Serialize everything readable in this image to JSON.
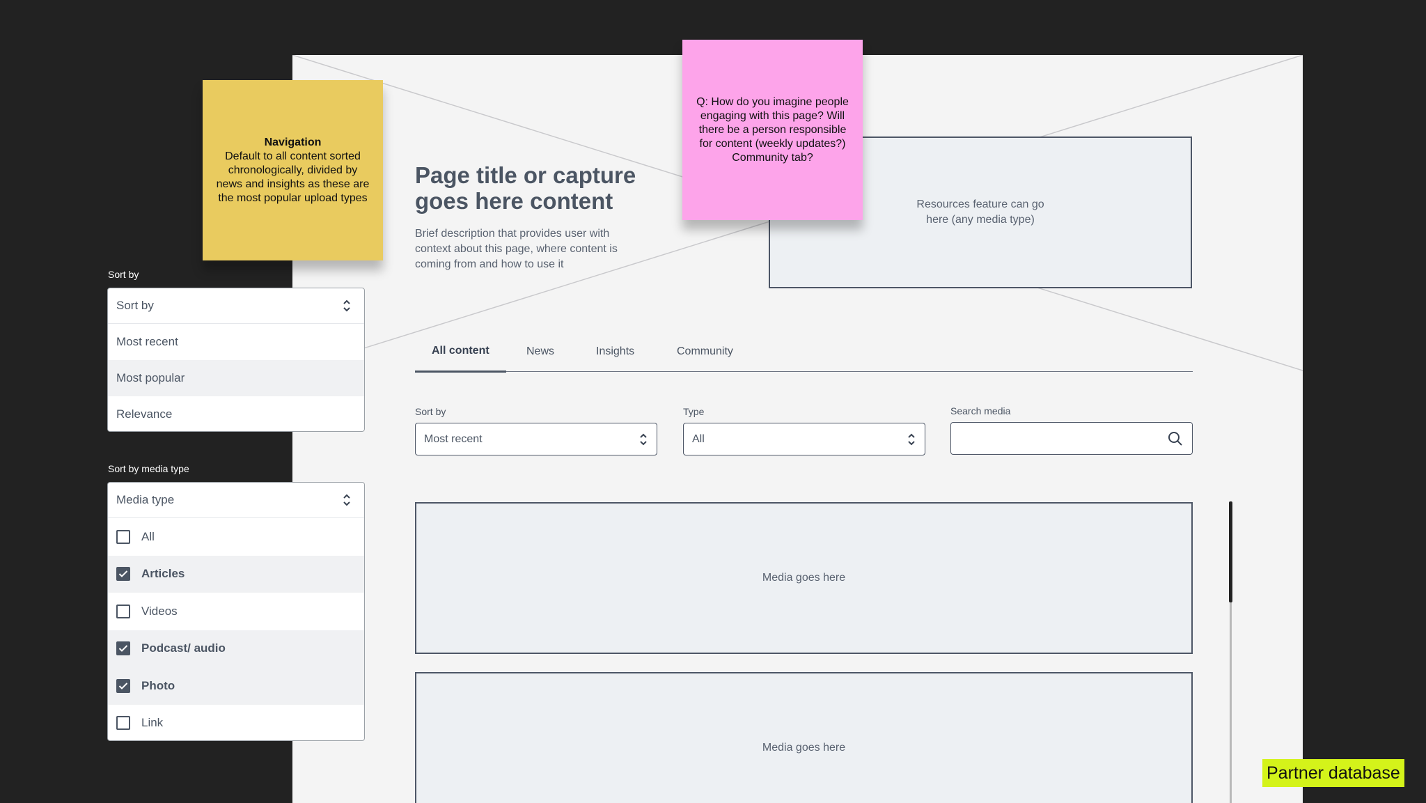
{
  "hero": {
    "title": "Page title or capture goes here content",
    "description": "Brief description that provides user with context about this page, where content is coming from and how to use it"
  },
  "resources_placeholder": "Resources feature can go here (any media type)",
  "tabs": [
    {
      "label": "All content",
      "active": true
    },
    {
      "label": "News",
      "active": false
    },
    {
      "label": "Insights",
      "active": false
    },
    {
      "label": "Community",
      "active": false
    }
  ],
  "filters": {
    "sort_label": "Sort by",
    "sort_value": "Most recent",
    "type_label": "Type",
    "type_value": "All",
    "search_label": "Search media",
    "search_value": ""
  },
  "media_placeholders": [
    "Media goes here",
    "Media goes here"
  ],
  "notes": {
    "navigation_title": "Navigation",
    "navigation_body": "Default to all content sorted chronologically, divided by news and insights as these are the most popular upload types",
    "question": "Q: How do you imagine people engaging with this page? Will there be a person responsible for content (weekly updates?) Community tab?"
  },
  "sort_panel": {
    "label": "Sort by",
    "placeholder": "Sort by",
    "options": [
      "Most recent",
      "Most popular",
      "Relevance"
    ],
    "highlighted_index": 1
  },
  "media_type_panel": {
    "label": "Sort by media type",
    "placeholder": "Media type",
    "options": [
      {
        "label": "All",
        "checked": false
      },
      {
        "label": "Articles",
        "checked": true
      },
      {
        "label": "Videos",
        "checked": false
      },
      {
        "label": "Podcast/ audio",
        "checked": true
      },
      {
        "label": "Photo",
        "checked": true
      },
      {
        "label": "Link",
        "checked": false
      }
    ]
  },
  "badge": "Partner database",
  "colors": {
    "background": "#222222",
    "canvas": "#f4f4f4",
    "note_yellow": "#e9cb5f",
    "note_pink": "#fda4ea",
    "badge": "#d4f31a",
    "placeholder_fill": "#edf0f3",
    "border": "#4d5666"
  },
  "icons": [
    "chevron-updown-icon",
    "search-icon",
    "checkmark-icon"
  ]
}
